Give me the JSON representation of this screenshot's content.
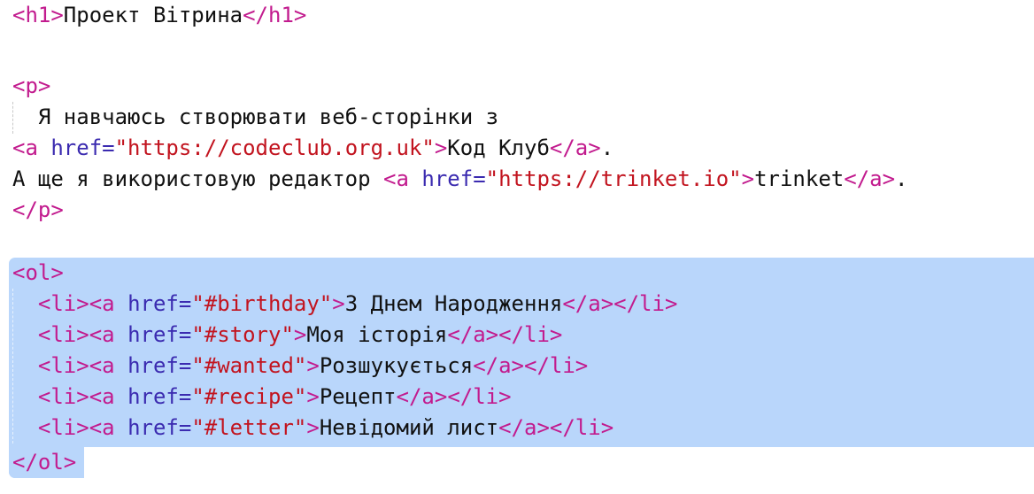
{
  "editor": {
    "colors": {
      "tag": "#c21b8e",
      "attribute": "#3b2bb0",
      "string": "#c2141f",
      "text": "#111111",
      "selection": "#b9d6fb"
    },
    "lines": [
      {
        "tokens": [
          {
            "type": "tag",
            "text": "<h1>"
          },
          {
            "type": "txt",
            "text": "Проект Вітрина"
          },
          {
            "type": "tag",
            "text": "</h1>"
          }
        ]
      },
      {
        "tokens": []
      },
      {
        "tokens": [
          {
            "type": "tag",
            "text": "<p>"
          }
        ]
      },
      {
        "tokens": [
          {
            "type": "txt",
            "text": "  Я навчаюсь створювати веб-сторінки з"
          }
        ]
      },
      {
        "tokens": [
          {
            "type": "tag",
            "text": "<a "
          },
          {
            "type": "attr",
            "text": "href="
          },
          {
            "type": "str",
            "text": "\"https://codeclub.org.uk\""
          },
          {
            "type": "tag",
            "text": ">"
          },
          {
            "type": "txt",
            "text": "Код Клуб"
          },
          {
            "type": "tag",
            "text": "</a>"
          },
          {
            "type": "txt",
            "text": "."
          }
        ]
      },
      {
        "tokens": [
          {
            "type": "txt",
            "text": "А ще я використовую редактор "
          },
          {
            "type": "tag",
            "text": "<a "
          },
          {
            "type": "attr",
            "text": "href="
          },
          {
            "type": "str",
            "text": "\"https://trinket.io\""
          },
          {
            "type": "tag",
            "text": ">"
          },
          {
            "type": "txt",
            "text": "trinket"
          },
          {
            "type": "tag",
            "text": "</a>"
          },
          {
            "type": "txt",
            "text": "."
          }
        ]
      },
      {
        "tokens": [
          {
            "type": "tag",
            "text": "</p>"
          }
        ]
      },
      {
        "tokens": []
      },
      {
        "tokens": [
          {
            "type": "tag",
            "text": "<ol>"
          }
        ]
      },
      {
        "tokens": [
          {
            "type": "txt",
            "text": "  "
          },
          {
            "type": "tag",
            "text": "<li><a "
          },
          {
            "type": "attr",
            "text": "href="
          },
          {
            "type": "str",
            "text": "\"#birthday\""
          },
          {
            "type": "tag",
            "text": ">"
          },
          {
            "type": "txt",
            "text": "З Днем Народження"
          },
          {
            "type": "tag",
            "text": "</a></li>"
          }
        ]
      },
      {
        "tokens": [
          {
            "type": "txt",
            "text": "  "
          },
          {
            "type": "tag",
            "text": "<li><a "
          },
          {
            "type": "attr",
            "text": "href="
          },
          {
            "type": "str",
            "text": "\"#story\""
          },
          {
            "type": "tag",
            "text": ">"
          },
          {
            "type": "txt",
            "text": "Моя історія"
          },
          {
            "type": "tag",
            "text": "</a></li>"
          }
        ]
      },
      {
        "tokens": [
          {
            "type": "txt",
            "text": "  "
          },
          {
            "type": "tag",
            "text": "<li><a "
          },
          {
            "type": "attr",
            "text": "href="
          },
          {
            "type": "str",
            "text": "\"#wanted\""
          },
          {
            "type": "tag",
            "text": ">"
          },
          {
            "type": "txt",
            "text": "Розшукується"
          },
          {
            "type": "tag",
            "text": "</a></li>"
          }
        ]
      },
      {
        "tokens": [
          {
            "type": "txt",
            "text": "  "
          },
          {
            "type": "tag",
            "text": "<li><a "
          },
          {
            "type": "attr",
            "text": "href="
          },
          {
            "type": "str",
            "text": "\"#recipe\""
          },
          {
            "type": "tag",
            "text": ">"
          },
          {
            "type": "txt",
            "text": "Рецепт"
          },
          {
            "type": "tag",
            "text": "</a></li>"
          }
        ]
      },
      {
        "tokens": [
          {
            "type": "txt",
            "text": "  "
          },
          {
            "type": "tag",
            "text": "<li><a "
          },
          {
            "type": "attr",
            "text": "href="
          },
          {
            "type": "str",
            "text": "\"#letter\""
          },
          {
            "type": "tag",
            "text": ">"
          },
          {
            "type": "txt",
            "text": "Невідомий лист"
          },
          {
            "type": "tag",
            "text": "</a></li>"
          }
        ]
      },
      {
        "tokens": [
          {
            "type": "tag",
            "text": "</ol>"
          }
        ]
      }
    ]
  }
}
